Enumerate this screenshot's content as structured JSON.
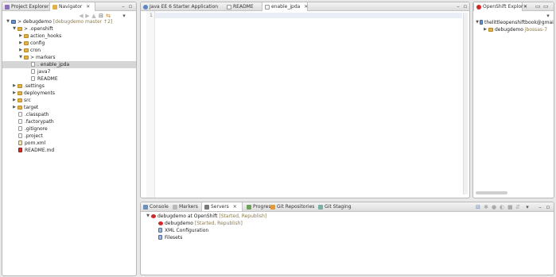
{
  "left_panel": {
    "tabs": [
      {
        "label": "Project Explorer",
        "active": false
      },
      {
        "label": "Navigator",
        "active": true
      }
    ],
    "tree": [
      {
        "label": "debugdemo",
        "decoration": "[debugdemo master ↑2]",
        "prefix": ">",
        "expanded": true
      },
      {
        "label": ".openshift",
        "prefix": ">",
        "expanded": true
      },
      {
        "label": "action_hooks",
        "expanded": false
      },
      {
        "label": "config",
        "expanded": false
      },
      {
        "label": "cron",
        "expanded": false
      },
      {
        "label": "markers",
        "prefix": ">",
        "expanded": true
      },
      {
        "label": "enable_jpda",
        "prefix": "."
      },
      {
        "label": "java7"
      },
      {
        "label": "README"
      },
      {
        "label": ".settings",
        "expanded": false
      },
      {
        "label": "deployments",
        "expanded": false
      },
      {
        "label": "src",
        "expanded": false
      },
      {
        "label": "target",
        "expanded": false
      },
      {
        "label": ".classpath"
      },
      {
        "label": ".factorypath"
      },
      {
        "label": ".gitignore"
      },
      {
        "label": ".project"
      },
      {
        "label": "pom.xml"
      },
      {
        "label": "README.md"
      }
    ]
  },
  "editor": {
    "tabs": [
      {
        "label": "Java EE 6 Starter Application",
        "active": false
      },
      {
        "label": "README",
        "active": false
      },
      {
        "label": "enable_jpda",
        "active": true
      }
    ],
    "line_numbers": [
      "1"
    ]
  },
  "right_panel": {
    "tabs": [
      {
        "label": "OpenShift Explor",
        "active": true
      }
    ],
    "tree": [
      {
        "label": "thelittleopenshiftbook@gmail.",
        "expanded": true
      },
      {
        "label": "debugdemo",
        "decoration": "jbossas-7",
        "expanded": false
      }
    ]
  },
  "bottom_panel": {
    "tabs": [
      {
        "label": "Console",
        "active": false
      },
      {
        "label": "Markers",
        "active": false
      },
      {
        "label": "Servers",
        "active": true
      },
      {
        "label": "Progress",
        "active": false
      },
      {
        "label": "Git Repositories",
        "active": false
      },
      {
        "label": "Git Staging",
        "active": false
      }
    ],
    "tree": [
      {
        "label": "debugdemo at OpenShift",
        "decoration": "[Started, Republish]",
        "expanded": true
      },
      {
        "label": "debugdemo",
        "decoration": "[Started, Republish]"
      },
      {
        "label": "XML Configuration"
      },
      {
        "label": "Filesets"
      }
    ]
  },
  "colors": {
    "accent_red": "#cf2a27",
    "folder": "#e2b046",
    "selection": "#d6d6d6",
    "editor_current_line": "#e9eef7"
  }
}
